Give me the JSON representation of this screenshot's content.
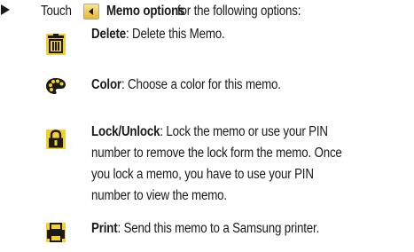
{
  "intro": {
    "before": "Touch",
    "button_label": "Memo options",
    "after": "for the following options:"
  },
  "options": [
    {
      "icon": "delete-trash-icon",
      "term": "Delete",
      "lines": [
        ": Delete this Memo."
      ]
    },
    {
      "icon": "palette-color-icon",
      "term": "Color",
      "lines": [
        ": Choose a color for this memo."
      ]
    },
    {
      "icon": "lock-icon",
      "term": "Lock/Unlock",
      "lines": [
        ": Lock the memo or use your PIN",
        "number to remove the lock form the memo. Once",
        "you lock a memo, you have to use your PIN",
        "number to view the memo."
      ]
    },
    {
      "icon": "printer-icon",
      "term": "Print",
      "lines": [
        ": Send this memo to a Samsung printer."
      ]
    }
  ],
  "colors": {
    "icon_yellow": "#f5d02a",
    "icon_dark": "#1a1a1a",
    "text": "#1a1a1a"
  }
}
